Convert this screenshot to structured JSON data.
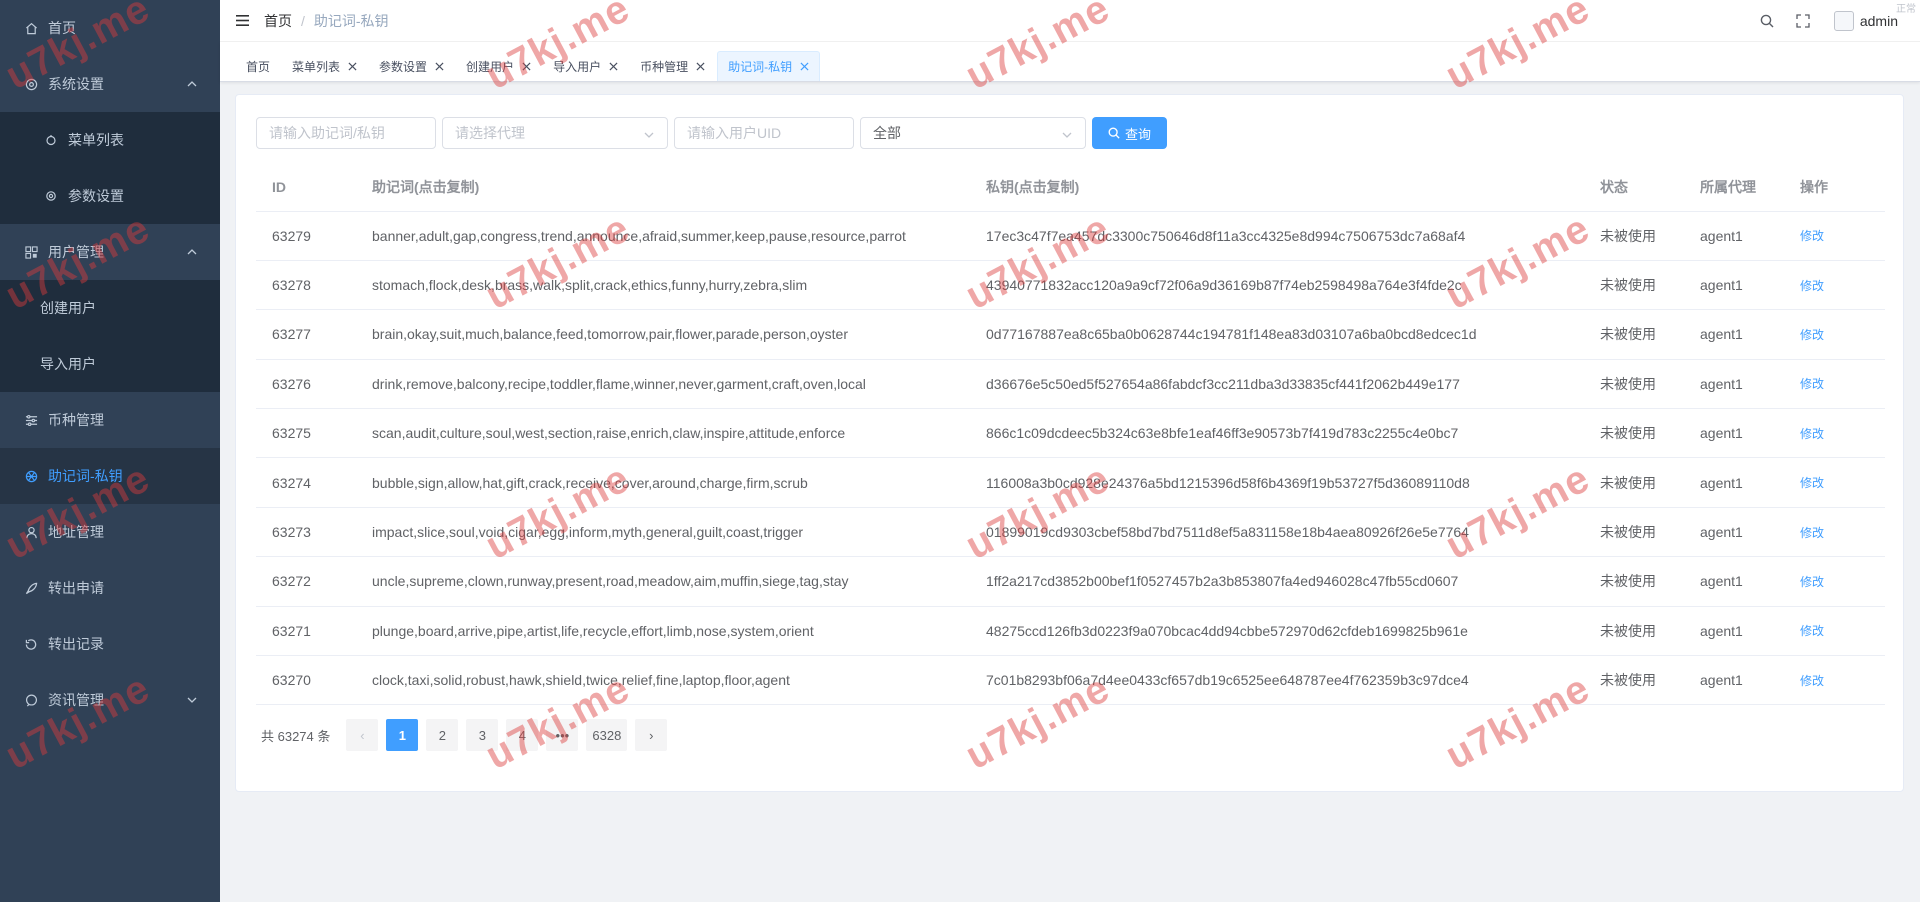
{
  "sidebar": {
    "items": [
      {
        "label": "首页",
        "icon": "home-icon",
        "type": "top"
      },
      {
        "label": "系统设置",
        "icon": "settings-icon",
        "type": "group",
        "arrow": "chevron-up-icon"
      },
      {
        "label": "菜单列表",
        "icon": "circle-icon",
        "type": "sub"
      },
      {
        "label": "参数设置",
        "icon": "gear-icon",
        "type": "sub"
      },
      {
        "label": "用户管理",
        "icon": "qrcode-icon",
        "type": "group",
        "arrow": "chevron-up-icon"
      },
      {
        "label": "创建用户",
        "icon": "",
        "type": "sub-plain"
      },
      {
        "label": "导入用户",
        "icon": "",
        "type": "sub-plain"
      },
      {
        "label": "币种管理",
        "icon": "sliders-icon",
        "type": "top"
      },
      {
        "label": "助记词-私钥",
        "icon": "aperture-icon",
        "type": "active"
      },
      {
        "label": "地址管理",
        "icon": "user-icon",
        "type": "top"
      },
      {
        "label": "转出申请",
        "icon": "rocket-icon",
        "type": "top"
      },
      {
        "label": "转出记录",
        "icon": "record-icon",
        "type": "top"
      },
      {
        "label": "资讯管理",
        "icon": "chat-icon",
        "type": "group",
        "arrow": "chevron-down-icon"
      }
    ]
  },
  "navbar": {
    "breadcrumb_home": "首页",
    "breadcrumb_sep": "/",
    "breadcrumb_current": "助记词-私钥",
    "username": "admin",
    "corner_text": "正常"
  },
  "tags": [
    {
      "label": "首页",
      "closable": false,
      "active": false
    },
    {
      "label": "菜单列表",
      "closable": true,
      "active": false
    },
    {
      "label": "参数设置",
      "closable": true,
      "active": false
    },
    {
      "label": "创建用户",
      "closable": true,
      "active": false
    },
    {
      "label": "导入用户",
      "closable": true,
      "active": false
    },
    {
      "label": "币种管理",
      "closable": true,
      "active": false
    },
    {
      "label": "助记词-私钥",
      "closable": true,
      "active": true
    }
  ],
  "filters": {
    "mnemonic_placeholder": "请输入助记词/私钥",
    "agent_placeholder": "请选择代理",
    "uid_placeholder": "请输入用户UID",
    "status_value": "全部",
    "query_label": "查询"
  },
  "table": {
    "columns": [
      "ID",
      "助记词(点击复制)",
      "私钥(点击复制)",
      "状态",
      "所属代理",
      "操作"
    ],
    "rows": [
      {
        "id": "63279",
        "mnemonic": "banner,adult,gap,congress,trend,announce,afraid,summer,keep,pause,resource,parrot",
        "key": "17ec3c47f7ea457dc3300c750646d8f11a3cc4325e8d994c7506753dc7a68af4",
        "status": "未被使用",
        "agent": "agent1",
        "action": "修改"
      },
      {
        "id": "63278",
        "mnemonic": "stomach,flock,desk,brass,walk,split,crack,ethics,funny,hurry,zebra,slim",
        "key": "43940771832acc120a9a9cf72f06a9d36169b87f74eb2598498a764e3f4fde2c",
        "status": "未被使用",
        "agent": "agent1",
        "action": "修改"
      },
      {
        "id": "63277",
        "mnemonic": "brain,okay,suit,much,balance,feed,tomorrow,pair,flower,parade,person,oyster",
        "key": "0d77167887ea8c65ba0b0628744c194781f148ea83d03107a6ba0bcd8edcec1d",
        "status": "未被使用",
        "agent": "agent1",
        "action": "修改"
      },
      {
        "id": "63276",
        "mnemonic": "drink,remove,balcony,recipe,toddler,flame,winner,never,garment,craft,oven,local",
        "key": "d36676e5c50ed5f527654a86fabdcf3cc211dba3d33835cf441f2062b449e177",
        "status": "未被使用",
        "agent": "agent1",
        "action": "修改"
      },
      {
        "id": "63275",
        "mnemonic": "scan,audit,culture,soul,west,section,raise,enrich,claw,inspire,attitude,enforce",
        "key": "866c1c09dcdeec5b324c63e8bfe1eaf46ff3e90573b7f419d783c2255c4e0bc7",
        "status": "未被使用",
        "agent": "agent1",
        "action": "修改"
      },
      {
        "id": "63274",
        "mnemonic": "bubble,sign,allow,hat,gift,crack,receive,cover,around,charge,firm,scrub",
        "key": "116008a3b0cd928e24376a5bd1215396d58f6b4369f19b53727f5d36089110d8",
        "status": "未被使用",
        "agent": "agent1",
        "action": "修改"
      },
      {
        "id": "63273",
        "mnemonic": "impact,slice,soul,void,cigar,egg,inform,myth,general,guilt,coast,trigger",
        "key": "01899019cd9303cbef58bd7bd7511d8ef5a831158e18b4aea80926f26e5e7764",
        "status": "未被使用",
        "agent": "agent1",
        "action": "修改"
      },
      {
        "id": "63272",
        "mnemonic": "uncle,supreme,clown,runway,present,road,meadow,aim,muffin,siege,tag,stay",
        "key": "1ff2a217cd3852b00bef1f0527457b2a3b853807fa4ed946028c47fb55cd0607",
        "status": "未被使用",
        "agent": "agent1",
        "action": "修改"
      },
      {
        "id": "63271",
        "mnemonic": "plunge,board,arrive,pipe,artist,life,recycle,effort,limb,nose,system,orient",
        "key": "48275ccd126fb3d0223f9a070bcac4dd94cbbe572970d62cfdeb1699825b961e",
        "status": "未被使用",
        "agent": "agent1",
        "action": "修改"
      },
      {
        "id": "63270",
        "mnemonic": "clock,taxi,solid,robust,hawk,shield,twice,relief,fine,laptop,floor,agent",
        "key": "7c01b8293bf06a7d4ee0433cf657db19c6525ee648787ee4f762359b3c97dce4",
        "status": "未被使用",
        "agent": "agent1",
        "action": "修改"
      }
    ]
  },
  "pagination": {
    "total_text": "共 63274 条",
    "prev": "‹",
    "next": "›",
    "pages": [
      "1",
      "2",
      "3",
      "4"
    ],
    "ellipsis": "•••",
    "last_page": "6328",
    "current": "1"
  },
  "watermark": {
    "text": "u7kj.me",
    "color": "#dc3c3c"
  },
  "colors": {
    "sidebar_bg": "#304156",
    "accent": "#409eff",
    "text": "#606266"
  }
}
